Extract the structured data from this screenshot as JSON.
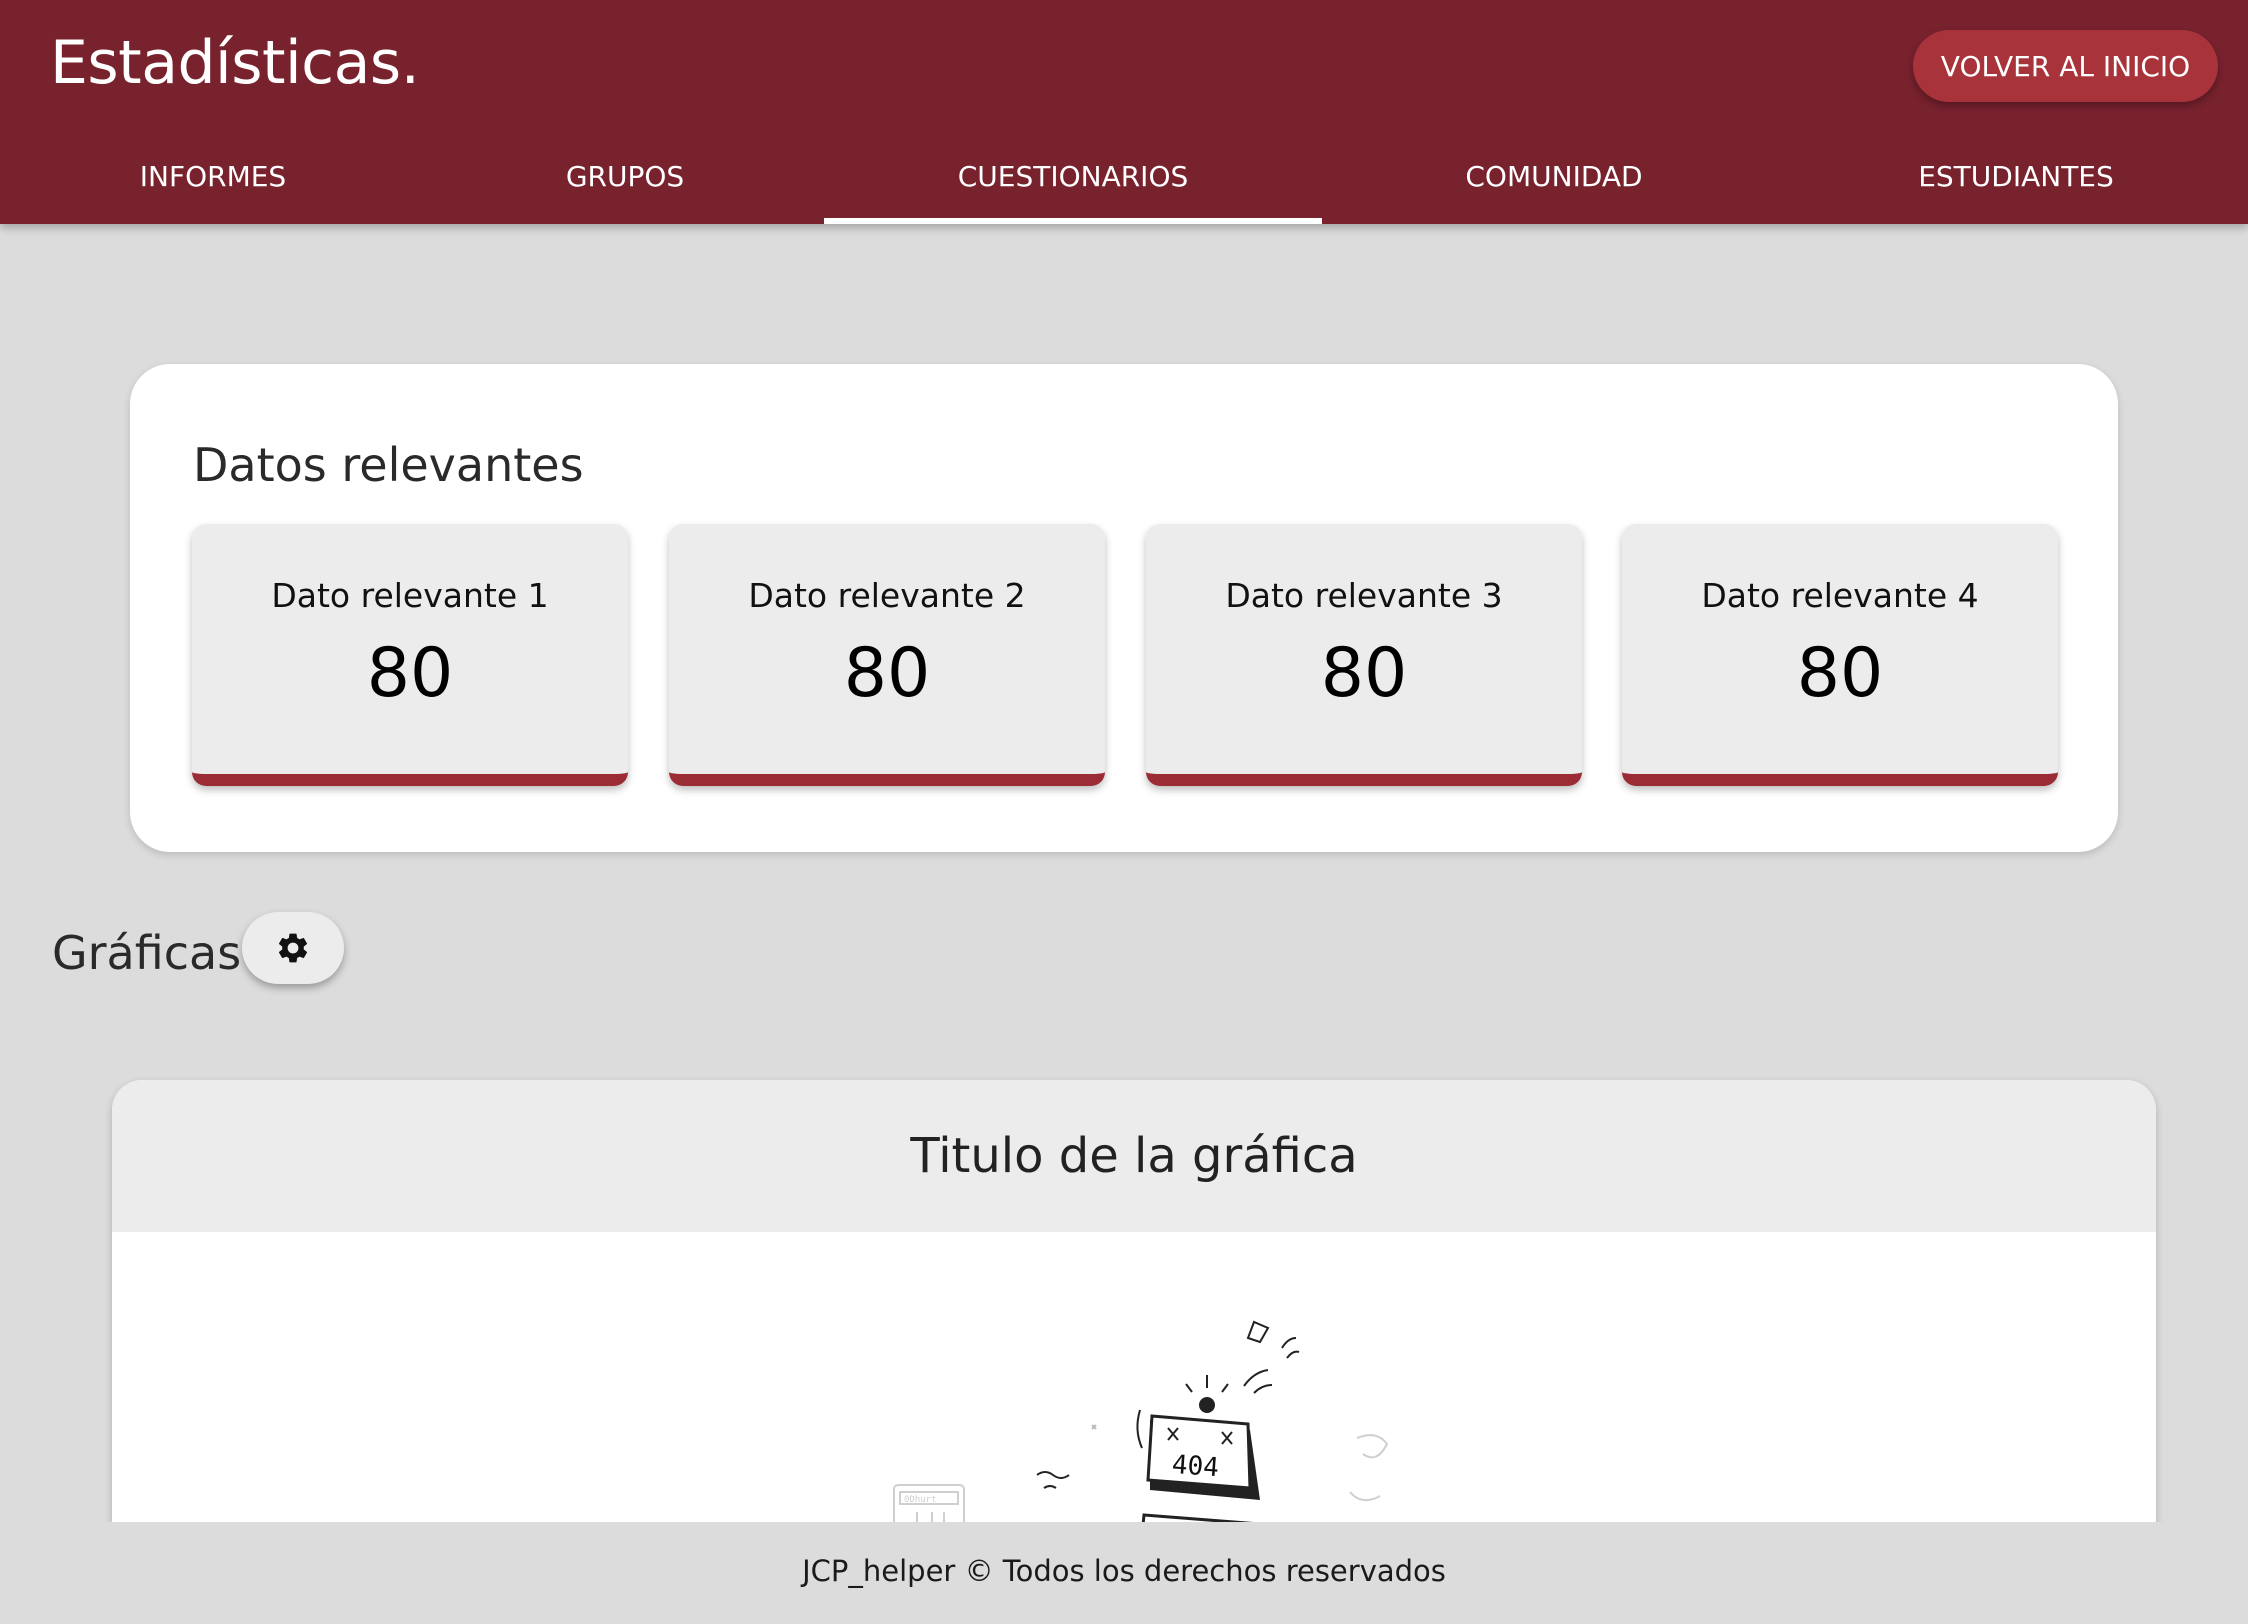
{
  "header": {
    "title": "Estadísticas.",
    "home_button": "VOLVER AL INICIO"
  },
  "tabs": [
    {
      "label": "INFORMES",
      "active": false
    },
    {
      "label": "GRUPOS",
      "active": false
    },
    {
      "label": "CUESTIONARIOS",
      "active": true
    },
    {
      "label": "COMUNIDAD",
      "active": false
    },
    {
      "label": "ESTUDIANTES",
      "active": false
    }
  ],
  "relevant": {
    "title": "Datos relevantes",
    "cards": [
      {
        "label": "Dato relevante 1",
        "value": "80"
      },
      {
        "label": "Dato relevante 2",
        "value": "80"
      },
      {
        "label": "Dato relevante 3",
        "value": "80"
      },
      {
        "label": "Dato relevante 4",
        "value": "80"
      }
    ]
  },
  "graphs": {
    "title": "Gráficas",
    "settings_icon": "gear-icon",
    "chart_title": "Titulo de la gráfica",
    "placeholder_text": "404",
    "placeholder_mini_text": "0Dhurt"
  },
  "footer": {
    "text": "JCP_helper © Todos los derechos reservados"
  },
  "colors": {
    "header": "#78222e",
    "accent": "#9b2b34",
    "button": "#a8333a",
    "background": "#dcdcdc",
    "card": "#ececec"
  }
}
